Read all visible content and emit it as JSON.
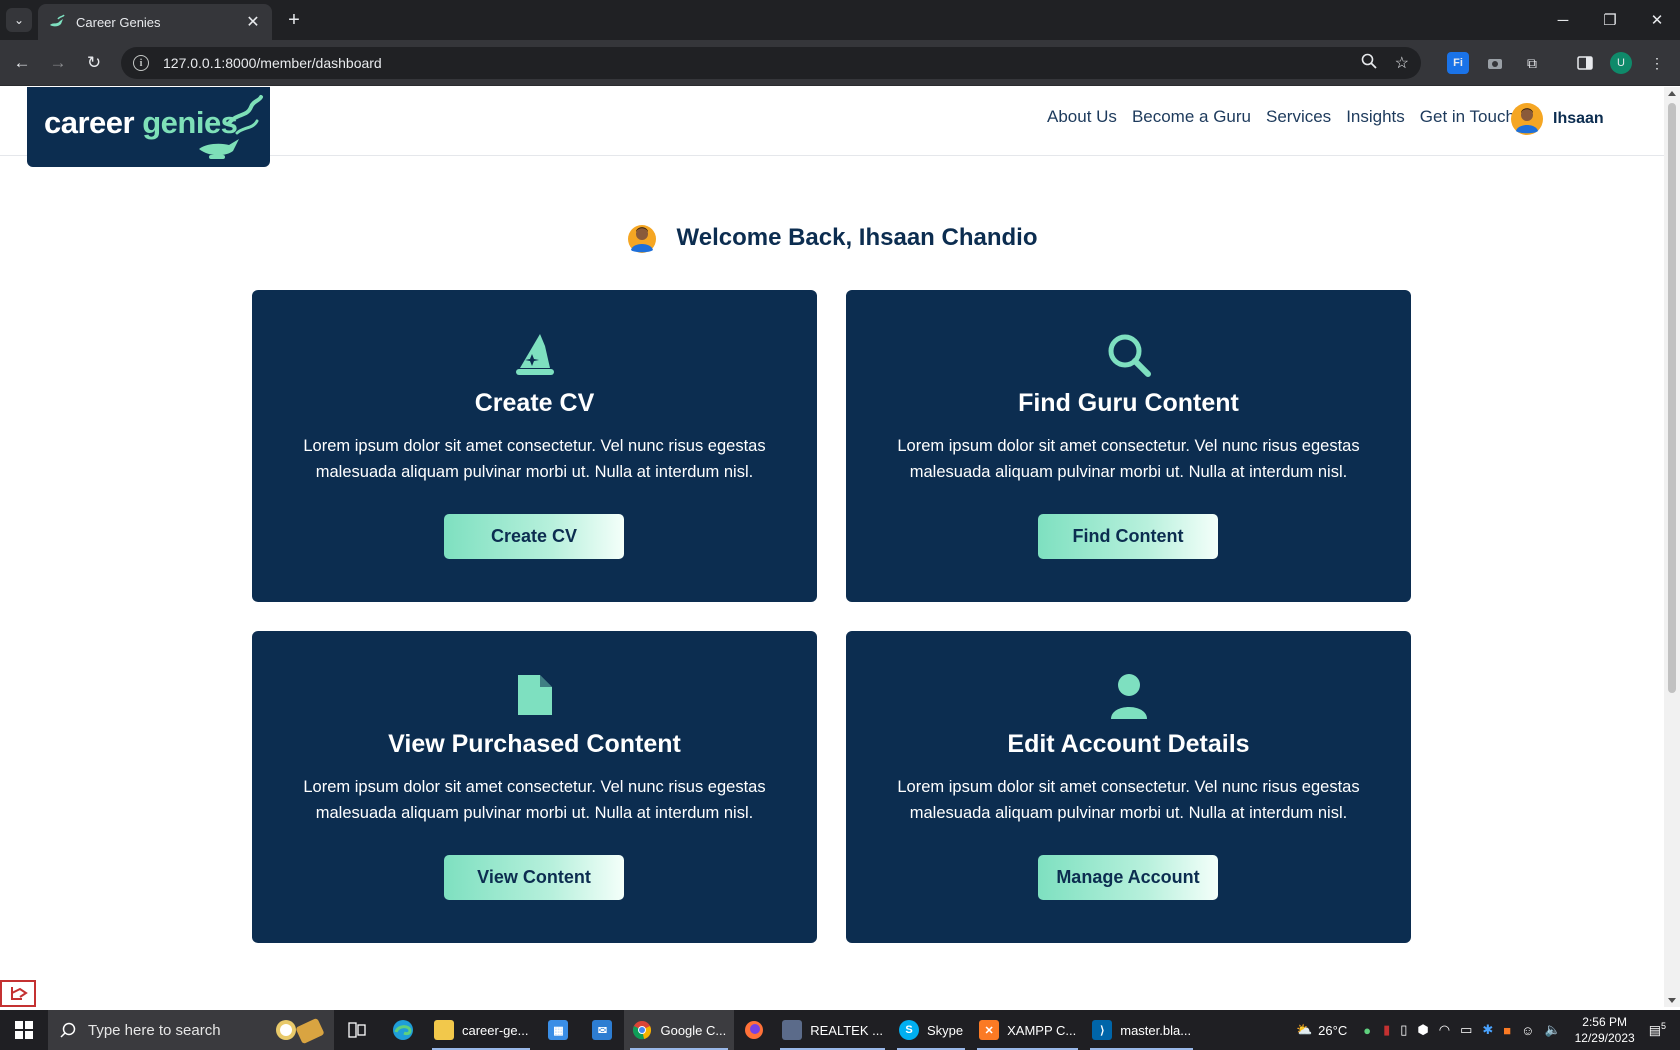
{
  "browser": {
    "tab_title": "Career Genies",
    "url": "127.0.0.1:8000/member/dashboard",
    "new_tab": "+",
    "tab_close": "✕"
  },
  "site": {
    "logo": {
      "career": "career ",
      "genies": "genies"
    },
    "nav": [
      "About Us",
      "Become a Guru",
      "Services",
      "Insights",
      "Get in Touch"
    ],
    "user_name": "Ihsaan"
  },
  "welcome": "Welcome Back, Ihsaan Chandio",
  "cards": [
    {
      "icon": "wizard-hat-icon",
      "title": "Create CV",
      "desc": "Lorem ipsum dolor sit amet consectetur. Vel nunc risus egestas malesuada aliquam pulvinar morbi ut. Nulla at interdum nisl.",
      "button": "Create CV"
    },
    {
      "icon": "search-icon",
      "title": "Find Guru Content",
      "desc": "Lorem ipsum dolor sit amet consectetur. Vel nunc risus egestas malesuada aliquam pulvinar morbi ut. Nulla at interdum nisl.",
      "button": "Find Content"
    },
    {
      "icon": "document-icon",
      "title": "View Purchased Content",
      "desc": "Lorem ipsum dolor sit amet consectetur. Vel nunc risus egestas malesuada aliquam pulvinar morbi ut. Nulla at interdum nisl.",
      "button": "View Content"
    },
    {
      "icon": "user-icon",
      "title": "Edit Account Details",
      "desc": "Lorem ipsum dolor sit amet consectetur. Vel nunc risus egestas malesuada aliquam pulvinar morbi ut. Nulla at interdum nisl.",
      "button": "Manage Account"
    }
  ],
  "taskbar": {
    "search_placeholder": "Type here to search",
    "apps": [
      "career-ge...",
      "Google C...",
      "REALTEK ...",
      "Skype",
      "XAMPP C...",
      "master.bla..."
    ],
    "weather": "26°C",
    "time": "2:56 PM",
    "date": "12/29/2023",
    "notifications": "5"
  },
  "colors": {
    "navy": "#0c2d50",
    "mint": "#7ee0c0"
  }
}
